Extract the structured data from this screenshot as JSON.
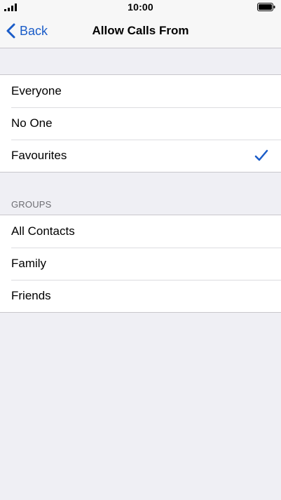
{
  "status_bar": {
    "time": "10:00"
  },
  "nav": {
    "back_label": "Back",
    "title": "Allow Calls From"
  },
  "options": [
    {
      "label": "Everyone",
      "selected": false
    },
    {
      "label": "No One",
      "selected": false
    },
    {
      "label": "Favourites",
      "selected": true
    }
  ],
  "groups_section": {
    "header": "GROUPS",
    "items": [
      {
        "label": "All Contacts"
      },
      {
        "label": "Family"
      },
      {
        "label": "Friends"
      }
    ]
  },
  "colors": {
    "accent": "#1a5cc8",
    "background": "#efeff4"
  }
}
